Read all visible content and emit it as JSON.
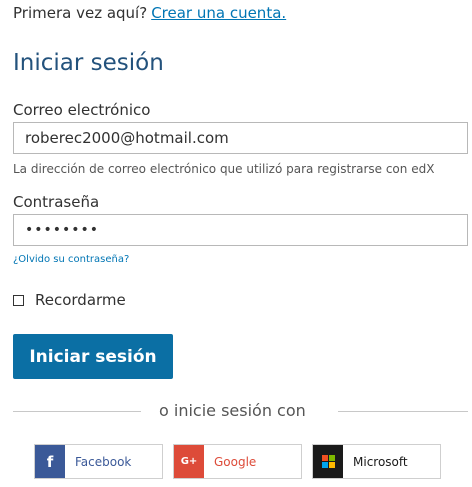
{
  "header": {
    "first_time_text": "Primera vez aquí?",
    "create_account_link": "Crear una cuenta."
  },
  "title": "Iniciar sesión",
  "email": {
    "label": "Correo electrónico",
    "value": "roberec2000@hotmail.com",
    "hint": "La dirección de correo electrónico que utilizó para registrarse con edX"
  },
  "password": {
    "label": "Contraseña",
    "value": "••••••••"
  },
  "forgot_password_link": "¿Olvido su contraseña?",
  "remember_me": {
    "label": "Recordarme",
    "checked": false
  },
  "signin_button": "Iniciar sesión",
  "divider_text": "o inicie sesión con",
  "social": [
    {
      "label": "Facebook",
      "icon": "facebook-icon",
      "glyph": "f",
      "color": "#3b5998"
    },
    {
      "label": "Google",
      "icon": "google-plus-icon",
      "glyph": "G+",
      "color": "#dd4b39"
    },
    {
      "label": "Microsoft",
      "icon": "microsoft-icon",
      "color": "#1a1a1a"
    }
  ],
  "colors": {
    "accent": "#0075b4",
    "button": "#0b6fa4",
    "title": "#23527c"
  }
}
